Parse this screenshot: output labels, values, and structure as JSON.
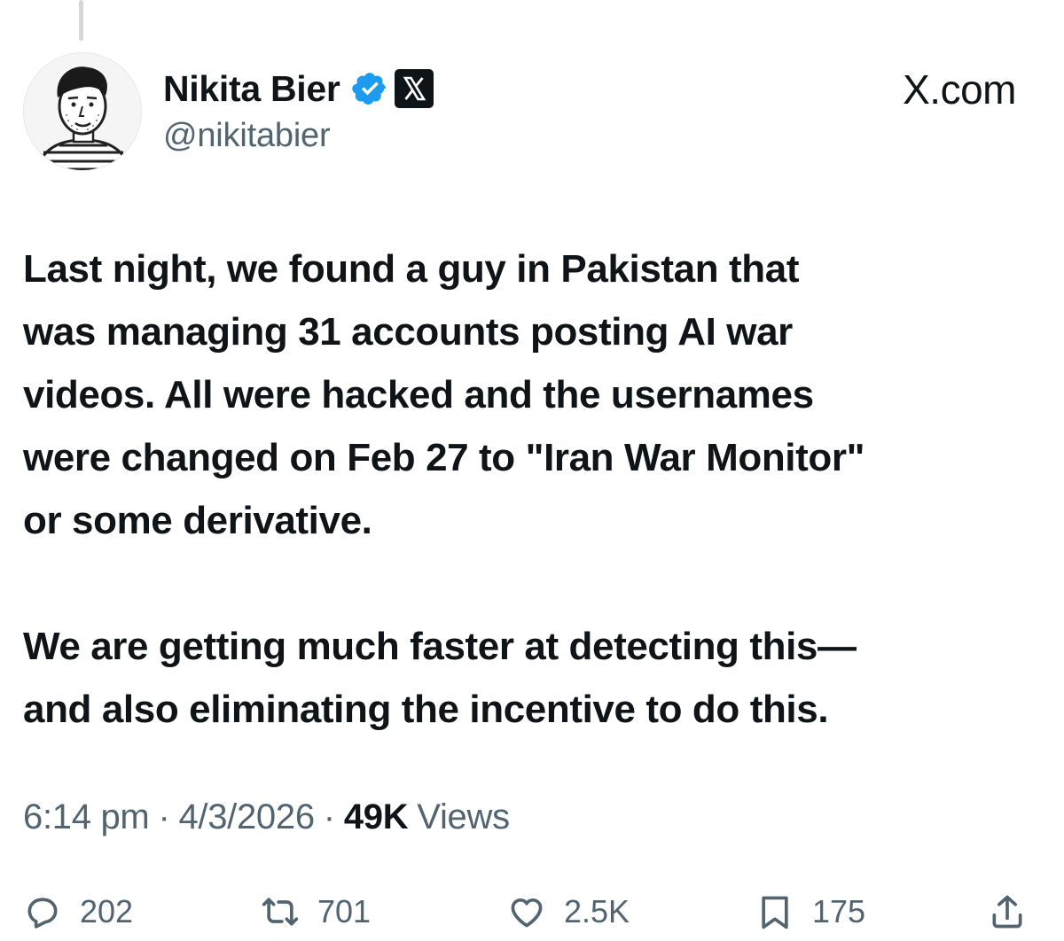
{
  "author": {
    "display_name": "Nikita Bier",
    "handle": "@nikitabier",
    "verified_badge": "verified-badge-icon",
    "affiliation_badge": "x-logo-icon"
  },
  "brand": {
    "label": "X.com"
  },
  "tweet": {
    "lines": [
      "Last night, we found a guy in Pakistan that",
      "was managing 31 accounts posting AI war",
      "videos. All were hacked and the usernames",
      "were changed on Feb 27 to \"Iran War Monitor\"",
      "or some derivative.",
      "We are getting much faster at detecting this—",
      "and also eliminating the incentive to do this."
    ]
  },
  "meta": {
    "time": "6:14 pm",
    "separator": "·",
    "date": "4/3/2026",
    "views_count": "49K",
    "views_label": "Views"
  },
  "actions": {
    "reply": {
      "icon": "reply-icon",
      "count": "202"
    },
    "repost": {
      "icon": "repost-icon",
      "count": "701"
    },
    "like": {
      "icon": "heart-icon",
      "count": "2.5K"
    },
    "bookmark": {
      "icon": "bookmark-icon",
      "count": "175"
    },
    "share": {
      "icon": "share-icon"
    }
  },
  "colors": {
    "text": "#0f1419",
    "secondary": "#536471",
    "verified_blue": "#1d9bf0",
    "thread_line": "#cfd9de"
  }
}
